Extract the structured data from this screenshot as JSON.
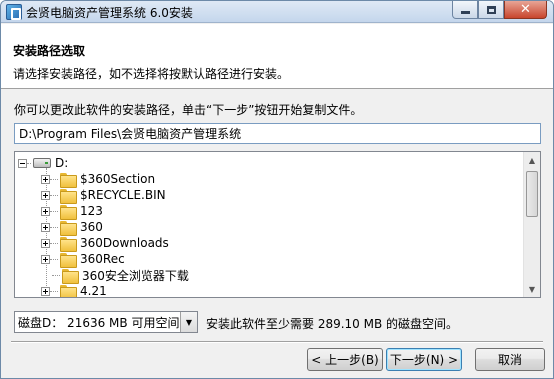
{
  "window": {
    "title": "会贤电脑资产管理系统 6.0安装"
  },
  "header": {
    "title": "安装路径选取",
    "subtitle": "请选择安装路径，如不选择将按默认路径进行安装。"
  },
  "instruction": "你可以更改此软件的安装路径，单击“下一步”按钮开始复制文件。",
  "path_input": {
    "value": "D:\\Program Files\\会贤电脑资产管理系统"
  },
  "tree": {
    "root_label": "D:",
    "items": [
      {
        "label": "$360Section",
        "expandable": true
      },
      {
        "label": "$RECYCLE.BIN",
        "expandable": true
      },
      {
        "label": "123",
        "expandable": true
      },
      {
        "label": "360",
        "expandable": true
      },
      {
        "label": "360Downloads",
        "expandable": true
      },
      {
        "label": "360Rec",
        "expandable": true
      },
      {
        "label": "360安全浏览器下载",
        "expandable": false
      },
      {
        "label": "4.21",
        "expandable": true
      }
    ]
  },
  "drive_select": {
    "selected": "磁盘D： 21636 MB 可用空间"
  },
  "space_required": "安装此软件至少需要 289.10 MB 的磁盘空间。",
  "buttons": {
    "back": "< 上一步(B)",
    "next": "下一步(N) >",
    "cancel": "取消"
  },
  "icons": {
    "app": "installer-icon",
    "drive": "hard-drive-icon",
    "folder": "folder-icon"
  }
}
